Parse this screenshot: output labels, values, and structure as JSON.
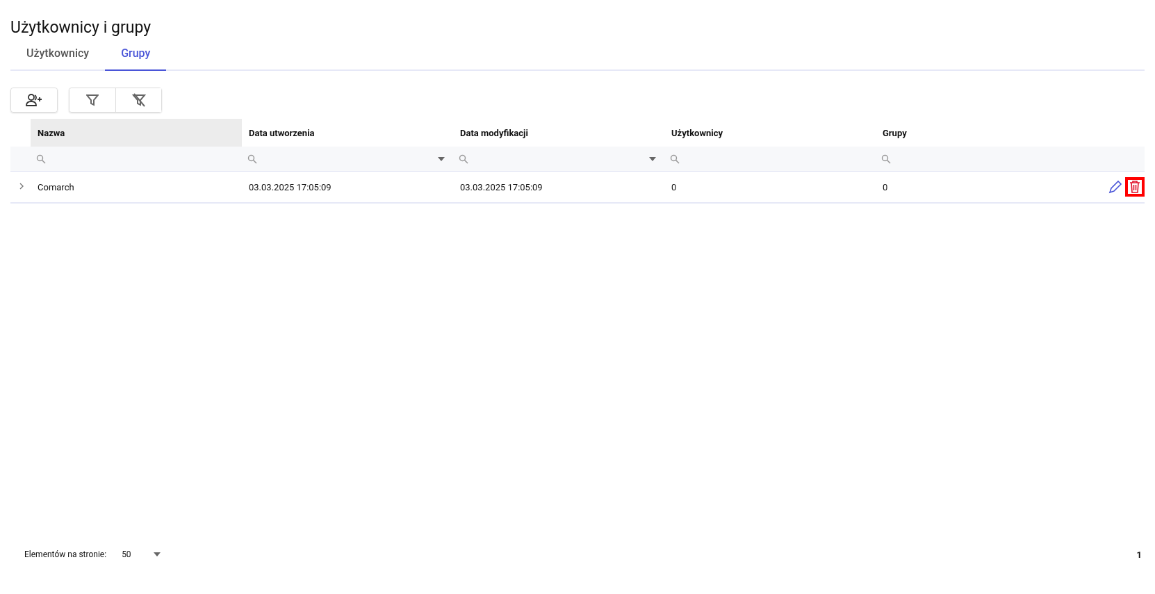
{
  "page": {
    "title": "Użytkownicy i grupy"
  },
  "tabs": [
    {
      "label": "Użytkownicy",
      "selected": false
    },
    {
      "label": "Grupy",
      "selected": true
    }
  ],
  "toolbar": [
    {
      "kind": "add-user"
    },
    {
      "kind": "filter"
    },
    {
      "kind": "clear-filter"
    }
  ],
  "table": {
    "columns": [
      {
        "label": "Nazwa",
        "highlighted": true,
        "dropdown": false
      },
      {
        "label": "Data utworzenia",
        "highlighted": false,
        "dropdown": true
      },
      {
        "label": "Data modyfikacji",
        "highlighted": false,
        "dropdown": true
      },
      {
        "label": "Użytkownicy",
        "highlighted": false,
        "dropdown": false
      },
      {
        "label": "Grupy",
        "highlighted": false,
        "dropdown": false
      }
    ],
    "rows": [
      {
        "expanded": false,
        "cells": [
          "Comarch",
          "03.03.2025 17:05:09",
          "03.03.2025 17:05:09",
          "0",
          "0"
        ],
        "delete_highlighted": true
      }
    ]
  },
  "pager": {
    "label": "Elementów na stronie:",
    "page_size": "50",
    "page": "1"
  }
}
